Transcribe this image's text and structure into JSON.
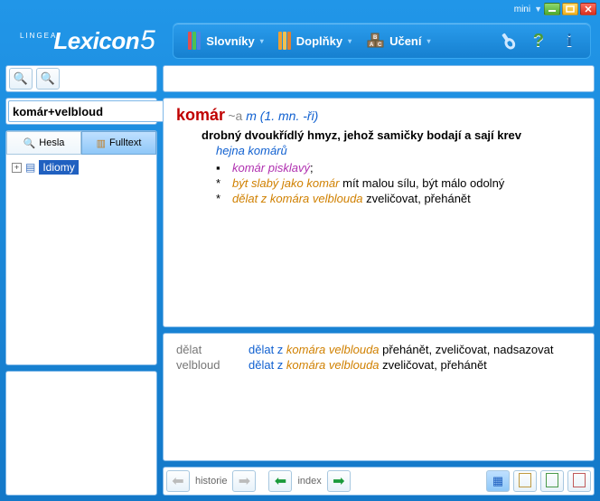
{
  "window": {
    "mini": "mini"
  },
  "logo": {
    "small": "LINGEA",
    "name": "Lexicon",
    "num": "5"
  },
  "menu": {
    "dictionaries": "Slovníky",
    "addons": "Doplňky",
    "learning": "Učení"
  },
  "left": {
    "search_value": "komár+velbloud",
    "tab_hesla": "Hesla",
    "tab_fulltext": "Fulltext",
    "tree_item": "Idiomy"
  },
  "entry": {
    "headword": "komár",
    "gram_prefix": "~a",
    "gram_gender": "m",
    "gram_paren": "(1. mn. -ři)",
    "definition": "drobný dvoukřídlý hmyz, jehož samičky bodají a sají krev",
    "example": "hejna komárů",
    "lines": [
      {
        "mark": "▪",
        "xref": "komár pisklavý",
        "rest": ";"
      },
      {
        "mark": "*",
        "collo": "být slabý jako komár",
        "meaning": " mít malou sílu, být málo odolný"
      },
      {
        "mark": "*",
        "collo": "dělat z komára velblouda",
        "meaning": " zveličovat, přehánět"
      }
    ]
  },
  "lower": {
    "rows": [
      {
        "head": "dělat",
        "pre": "dělat z ",
        "collo": "komára velblouda",
        "post": " přehánět, zveličovat, nadsazovat"
      },
      {
        "head": "velbloud",
        "pre": "dělat z ",
        "collo": "komára velblouda",
        "post": " zveličovat, přehánět"
      }
    ]
  },
  "nav": {
    "history": "historie",
    "index": "index"
  }
}
